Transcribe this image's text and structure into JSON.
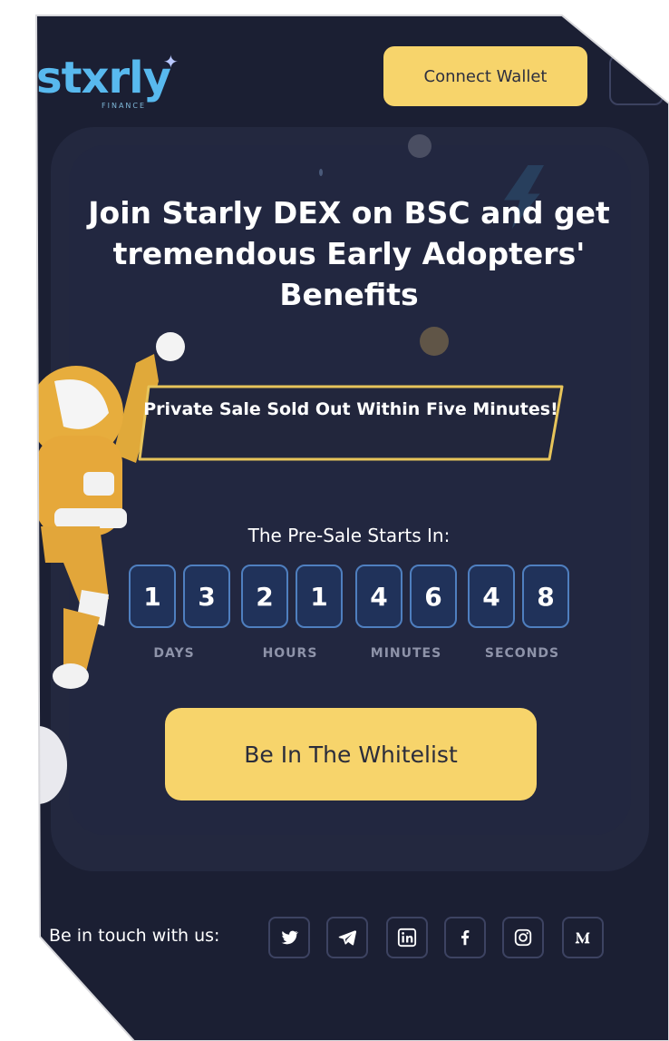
{
  "header": {
    "logo_text": "stxrly",
    "logo_sub": "FINANCE",
    "connect_label": "Connect Wallet"
  },
  "hero": {
    "title": "Join Starly DEX on BSC and get tremendous Early Adopters' Benefits",
    "banner": "Private Sale Sold Out Within Five Minutes!"
  },
  "countdown": {
    "title": "The Pre-Sale Starts In:",
    "digits": [
      "1",
      "3",
      "2",
      "1",
      "4",
      "6",
      "4",
      "8"
    ],
    "units": [
      "DAYS",
      "HOURS",
      "MINUTES",
      "SECONDS"
    ]
  },
  "cta": {
    "whitelist_label": "Be In The Whitelist"
  },
  "footer": {
    "social_label": "Be in touch with us:",
    "social_icons": [
      "twitter-icon",
      "telegram-icon",
      "linkedin-icon",
      "facebook-icon",
      "instagram-icon",
      "medium-icon"
    ]
  },
  "colors": {
    "background": "#1b1f33",
    "card": "#23283f",
    "accent_yellow": "#f7d46b",
    "digit_border": "#4f7fbf",
    "logo_blue": "#58b9ee"
  }
}
